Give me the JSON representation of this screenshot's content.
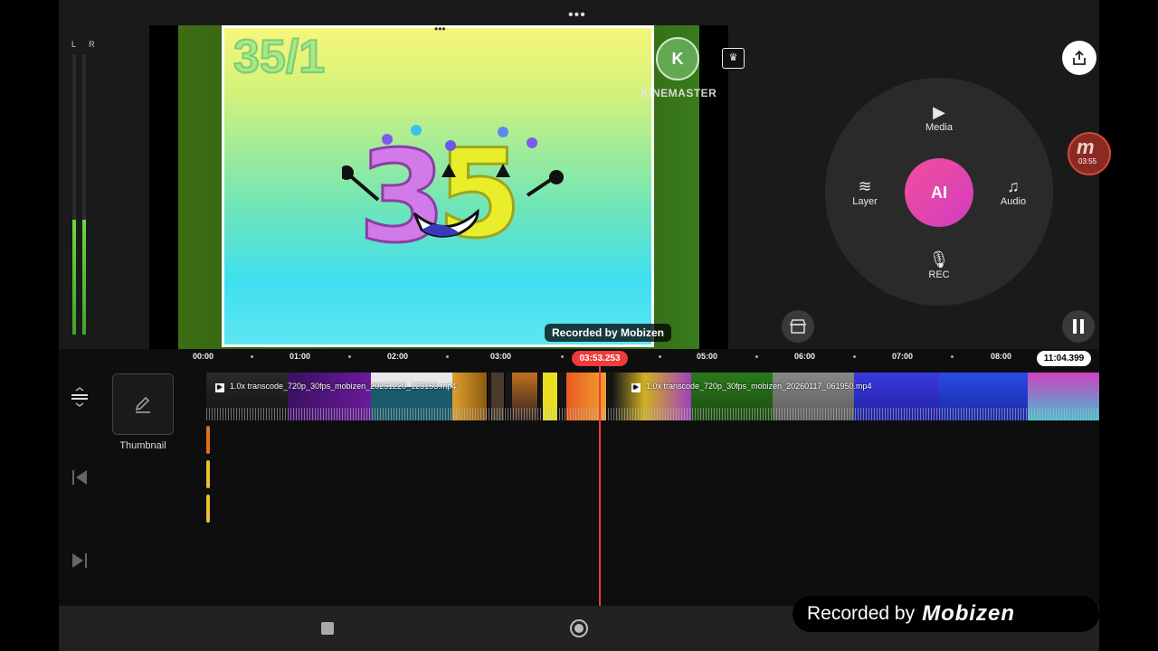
{
  "top": {
    "menu_dots": "•••"
  },
  "meter": {
    "labels": "L R",
    "left_level": 0.41,
    "right_level": 0.41
  },
  "preview": {
    "title_overlay": "35/1",
    "watermark_logo": "K",
    "watermark_text": "KINEMASTER",
    "recorded_small": "Recorded by Mobizen"
  },
  "wheel": {
    "media": "Media",
    "layer": "Layer",
    "audio": "Audio",
    "rec": "REC",
    "ai": "AI"
  },
  "floating": {
    "mobizen_time": "03:55"
  },
  "ruler": {
    "ticks": [
      "00:00",
      "01:00",
      "02:00",
      "03:00",
      "05:00",
      "06:00",
      "07:00",
      "08:00"
    ],
    "playhead_time": "03:53.253",
    "end_time": "11:04.399"
  },
  "clips": {
    "clip1_label": "1.0x transcode_720p_30fps_mobizen_20251220_123153.mp4",
    "clip2_label": "1.0x transcode_720p_30fps_mobizen_20260117_061950.mp4"
  },
  "thumbnail": {
    "label": "Thumbnail"
  },
  "recorded_badge": {
    "prefix": "Recorded by",
    "brand": "Mobizen"
  },
  "colors": {
    "accent": "#ee3b3b",
    "ai_gradient_start": "#f0509a",
    "ai_gradient_end": "#d33cc1",
    "meter": "#5fcf34"
  }
}
